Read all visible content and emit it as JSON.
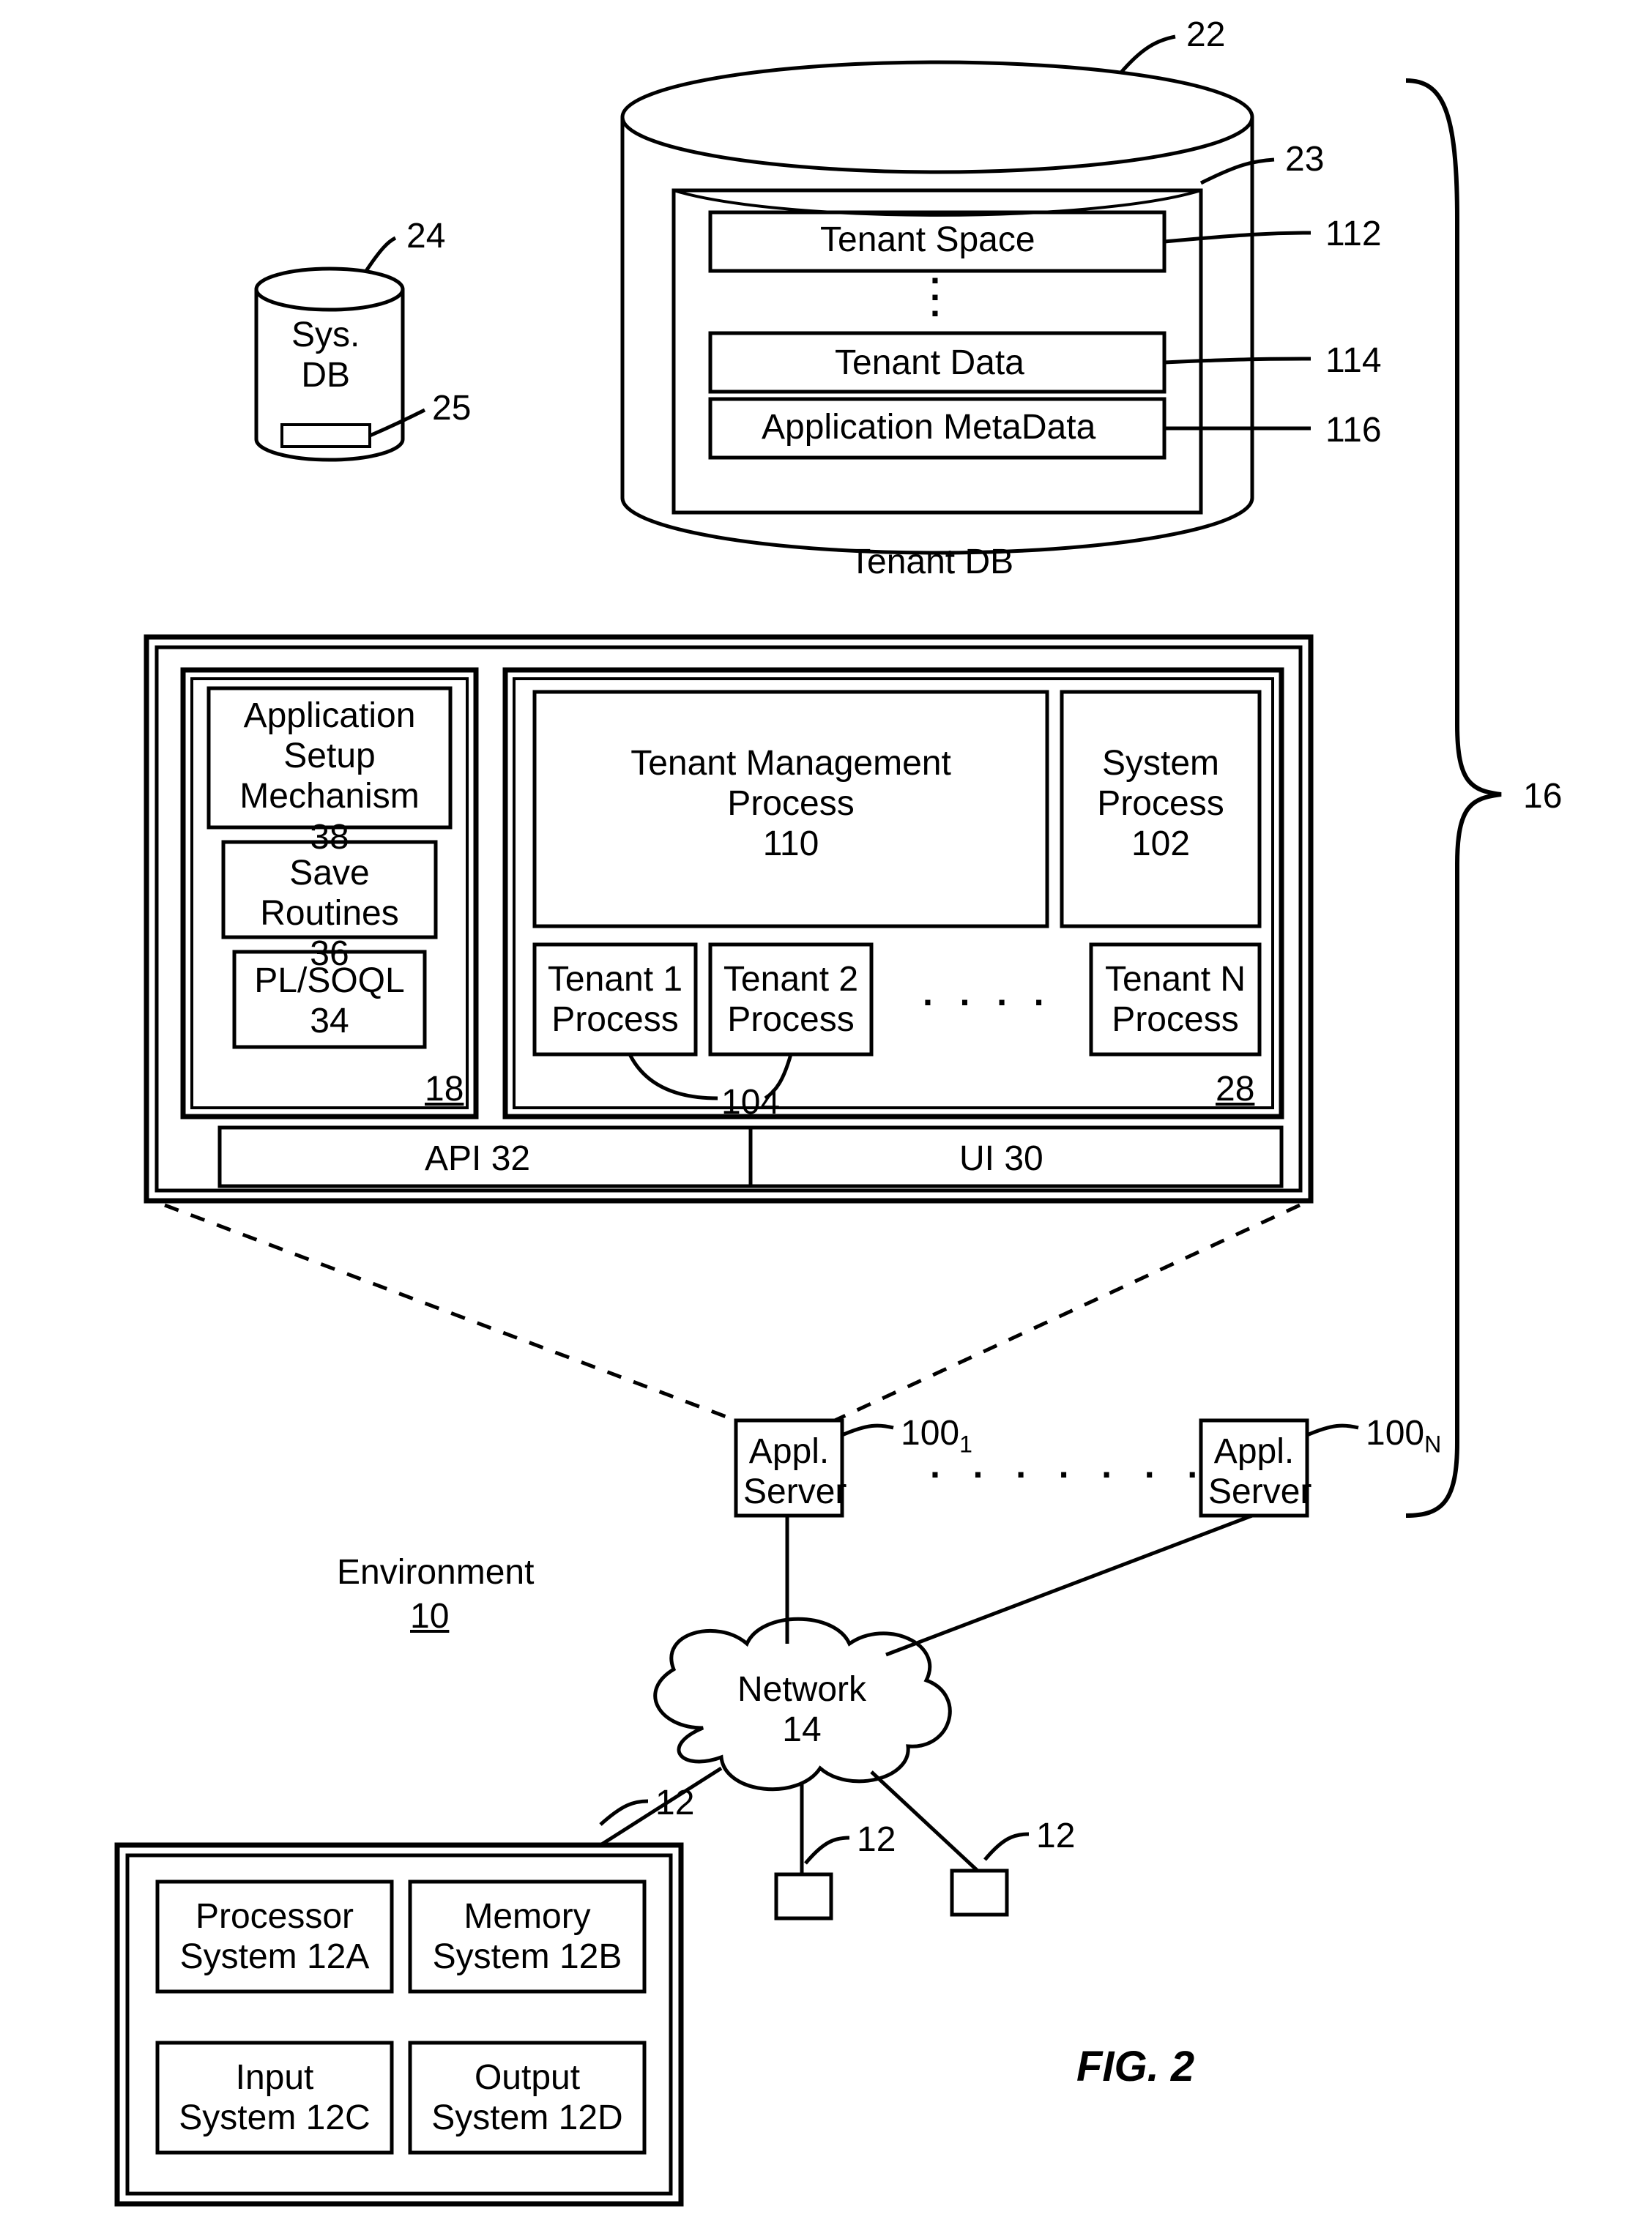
{
  "figure": "FIG. 2",
  "refs": {
    "tenantDB": "22",
    "tenantDBInner": "23",
    "sysDB": "24",
    "sysDBInner": "25",
    "tenantSpace": "112",
    "tenantData": "114",
    "appMetaData": "116",
    "systemGroup": "16",
    "leftInner": "18",
    "rightInner": "28",
    "api": "API 32",
    "ui": "UI 30",
    "appSetup": "Application\nSetup\nMechanism 38",
    "saveRoutines": "Save\nRoutines 36",
    "plsoql": "PL/SOQL\n34",
    "tmp": "Tenant Management\nProcess\n110",
    "sysProc": "System\nProcess\n102",
    "t1": "Tenant 1\nProcess",
    "t2": "Tenant 2\nProcess",
    "tN": "Tenant N\nProcess",
    "tRef": "104",
    "appServer1": "Appl.\nServer",
    "appServer1Ref": "100",
    "appServer1Sub": "1",
    "appServerN": "Appl.\nServer",
    "appServerNRef": "100",
    "appServerNSub": "N",
    "env": "Environment",
    "envRef": "10",
    "network": "Network\n14",
    "userSys": "12",
    "procSys": "Processor\nSystem 12A",
    "memSys": "Memory\nSystem 12B",
    "inSys": "Input\nSystem 12C",
    "outSys": "Output\nSystem 12D"
  },
  "labels": {
    "sysDB": "Sys.\nDB",
    "tenantDB": "Tenant DB",
    "tenantSpace": "Tenant Space",
    "tenantData": "Tenant Data",
    "appMetaData": "Application MetaData"
  }
}
